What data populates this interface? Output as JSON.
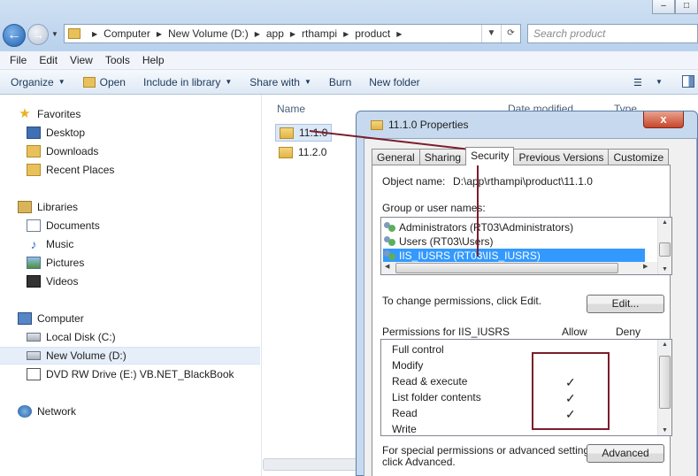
{
  "explorer": {
    "address_crumbs": [
      "Computer",
      "New Volume (D:)",
      "app",
      "rthampi",
      "product"
    ],
    "search_placeholder": "Search product",
    "menu": [
      "File",
      "Edit",
      "View",
      "Tools",
      "Help"
    ],
    "commands": {
      "organize": "Organize",
      "open": "Open",
      "include_in_library": "Include in library",
      "share_with": "Share with",
      "burn": "Burn",
      "new_folder": "New folder"
    },
    "nav": {
      "favorites": "Favorites",
      "desktop": "Desktop",
      "downloads": "Downloads",
      "recent_places": "Recent Places",
      "libraries": "Libraries",
      "documents": "Documents",
      "music": "Music",
      "pictures": "Pictures",
      "videos": "Videos",
      "computer": "Computer",
      "local_disk": "Local Disk (C:)",
      "new_volume": "New Volume (D:)",
      "dvd": "DVD RW Drive (E:) VB.NET_BlackBook",
      "network": "Network"
    },
    "columns": {
      "name": "Name",
      "date_modified": "Date modified",
      "type": "Type"
    },
    "files": [
      "11.1.0",
      "11.2.0"
    ]
  },
  "dialog": {
    "title": "11.1.0 Properties",
    "close_label": "x",
    "tabs": [
      "General",
      "Sharing",
      "Security",
      "Previous Versions",
      "Customize"
    ],
    "object_name_label": "Object name:",
    "object_name_value": "D:\\app\\rthampi\\product\\11.1.0",
    "group_label": "Group or user names:",
    "users": [
      "Administrators (RT03\\Administrators)",
      "Users (RT03\\Users)",
      "IIS_IUSRS (RT03\\IIS_IUSRS)"
    ],
    "change_perm_text": "To change permissions, click Edit.",
    "edit_button": "Edit...",
    "permissions_for": "Permissions for IIS_IUSRS",
    "allow": "Allow",
    "deny": "Deny",
    "permissions": [
      {
        "name": "Full control",
        "allow": ""
      },
      {
        "name": "Modify",
        "allow": ""
      },
      {
        "name": "Read & execute",
        "allow": "✓"
      },
      {
        "name": "List folder contents",
        "allow": "✓"
      },
      {
        "name": "Read",
        "allow": "✓"
      },
      {
        "name": "Write",
        "allow": ""
      }
    ],
    "special_text_1": "For special permissions or advanced settings,",
    "special_text_2": "click Advanced.",
    "advanced_button": "Advanced"
  }
}
